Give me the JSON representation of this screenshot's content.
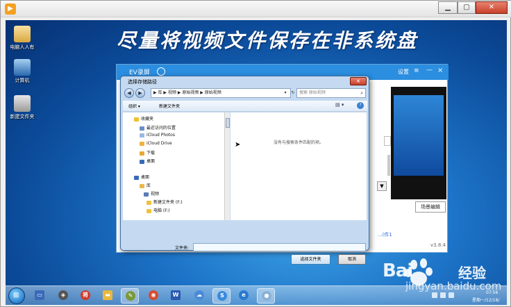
{
  "banner": {
    "text": "尽量将视频文件保存在非系统盘"
  },
  "desktop_icons": [
    {
      "label": "电脑人人有"
    },
    {
      "label": "计算机"
    },
    {
      "label": "新建文件夹"
    }
  ],
  "ev_window": {
    "title": "EV录屏",
    "settings_label": "设置",
    "menu_glyph": "≡",
    "minimize_glyph": "—",
    "close_glyph": "×",
    "scene_button": "场景编辑",
    "link_text": "...(件1",
    "version": "v3.8.4"
  },
  "dialog": {
    "title": "选择存储路径",
    "close_glyph": "×",
    "address_path": "▶ 库 ▶ 视频 ▶ 原始视频 ▶ 原始视频",
    "search_placeholder": "搜索 原始视频",
    "toolbar": {
      "organize": "组织 ▾",
      "new_folder": "新建文件夹",
      "view_glyph": "▤ ▾",
      "help_glyph": "?"
    },
    "tree": [
      {
        "label": "收藏夹",
        "icon": "star-icon",
        "color": "#f0c030"
      },
      {
        "label": "最近访问的位置",
        "icon": "recent-icon",
        "color": "#6a8fc8"
      },
      {
        "label": "iCloud Photos",
        "icon": "cloud-icon",
        "color": "#9ab8e0"
      },
      {
        "label": "iCloud Drive",
        "icon": "cloud-drive-icon",
        "color": "#f0b040"
      },
      {
        "label": "下载",
        "icon": "download-icon",
        "color": "#e8a838"
      },
      {
        "label": "桌面",
        "icon": "desktop-icon",
        "color": "#3a6ab8"
      },
      {
        "label": "桌面",
        "icon": "desktop-icon",
        "color": "#3a6ab8"
      },
      {
        "label": "库",
        "icon": "library-icon",
        "color": "#e8b850"
      },
      {
        "label": "视频",
        "icon": "video-icon",
        "color": "#5a7ab8"
      },
      {
        "label": "新建文件夹 (F:)",
        "icon": "folder-icon",
        "color": "#f0c040"
      },
      {
        "label": "电脑 (F:)",
        "icon": "folder-icon",
        "color": "#f0c040"
      }
    ],
    "empty_message": "没有与搜索条件匹配的项。",
    "filename_label": "文件夹:",
    "filename_value": "",
    "select_button": "选择文件夹",
    "cancel_button": "取消"
  },
  "taskbar": {
    "start_glyph": "⊞",
    "time": "07:56",
    "date": "星期一/12/18/",
    "apps": [
      {
        "name": "monitor",
        "glyph": "▭",
        "color": "#3a6ab8"
      },
      {
        "name": "network",
        "glyph": "◈",
        "color": "#555"
      },
      {
        "name": "jiang-app",
        "glyph": "将",
        "color": "#d23a2a"
      },
      {
        "name": "folder",
        "glyph": "▬",
        "color": "#e8b840"
      },
      {
        "name": "paint",
        "glyph": "✎",
        "color": "#7a9a3a"
      },
      {
        "name": "chrome",
        "glyph": "◉",
        "color": "#d84a30"
      },
      {
        "name": "word",
        "glyph": "W",
        "color": "#2a5ab0"
      },
      {
        "name": "cloud",
        "glyph": "☁",
        "color": "#4a8ad8"
      },
      {
        "name": "sogou",
        "glyph": "S",
        "color": "#3a8ad8"
      },
      {
        "name": "ie",
        "glyph": "e",
        "color": "#2a7ad0"
      },
      {
        "name": "recorder",
        "glyph": "●",
        "color": "#8ab0d8"
      }
    ]
  },
  "watermark": {
    "brand_a": "Bai",
    "brand_b": "经验",
    "url": "jingyan.baidu.com"
  }
}
